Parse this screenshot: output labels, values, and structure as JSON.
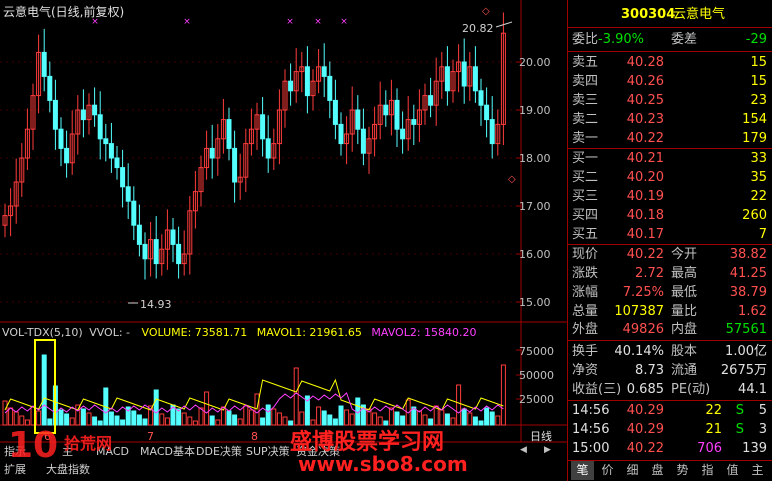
{
  "chart": {
    "title": "云意电气(日线,前复权)",
    "high_label": "20.82",
    "low_label": "14.93",
    "price_axis": [
      "20.00",
      "19.00",
      "18.00",
      "17.00",
      "16.00",
      "15.00"
    ],
    "vol_axis": [
      "75000",
      "50000",
      "25000"
    ],
    "vol_indicator": "VOL-TDX(5,10)",
    "vol_vvol": "VVOL: -",
    "vol_volume": "VOLUME: 73581.71",
    "vol_mavol1": "MAVOL1: 21961.65",
    "vol_mavol2": "MAVOL2: 15840.20",
    "month_marks": [
      "6",
      "7",
      "8"
    ],
    "period_label": "日线",
    "tabs_row1": [
      "指示",
      "主",
      "MACD",
      "MACD基本",
      "DDE决策",
      "SUP决策",
      "资金决策"
    ],
    "tabs_row2": [
      "扩展",
      "大盘指数"
    ],
    "colors": {
      "up": "#ff3c3c",
      "down": "#54ffff",
      "ma1": "#ffff00",
      "ma2": "#ff40ff",
      "border": "#a00000"
    }
  },
  "quote": {
    "code": "300304",
    "name": "云意电气",
    "weibi_label": "委比",
    "weibi": "-3.90%",
    "weicha_label": "委差",
    "weicha": "-29",
    "asks": [
      {
        "label": "卖五",
        "price": "40.28",
        "vol": "15"
      },
      {
        "label": "卖四",
        "price": "40.26",
        "vol": "15"
      },
      {
        "label": "卖三",
        "price": "40.25",
        "vol": "23"
      },
      {
        "label": "卖二",
        "price": "40.23",
        "vol": "154"
      },
      {
        "label": "卖一",
        "price": "40.22",
        "vol": "179"
      }
    ],
    "bids": [
      {
        "label": "买一",
        "price": "40.21",
        "vol": "33"
      },
      {
        "label": "买二",
        "price": "40.20",
        "vol": "35"
      },
      {
        "label": "买三",
        "price": "40.19",
        "vol": "22"
      },
      {
        "label": "买四",
        "price": "40.18",
        "vol": "260"
      },
      {
        "label": "买五",
        "price": "40.17",
        "vol": "7"
      }
    ],
    "stats": [
      {
        "l1": "现价",
        "v1": "40.22",
        "c1": "red",
        "l2": "今开",
        "v2": "38.82",
        "c2": "red"
      },
      {
        "l1": "涨跌",
        "v1": "2.72",
        "c1": "red",
        "l2": "最高",
        "v2": "41.25",
        "c2": "red"
      },
      {
        "l1": "涨幅",
        "v1": "7.25%",
        "c1": "red",
        "l2": "最低",
        "v2": "38.79",
        "c2": "red"
      },
      {
        "l1": "总量",
        "v1": "107387",
        "c1": "yel",
        "l2": "量比",
        "v2": "1.62",
        "c2": "red"
      }
    ],
    "outer": {
      "l1": "外盘",
      "v1": "49826",
      "l2": "内盘",
      "v2": "57561"
    },
    "fund": [
      {
        "l1": "换手",
        "v1": "40.14%",
        "l2": "股本",
        "v2": "1.00亿"
      },
      {
        "l1": "净资",
        "v1": "8.73",
        "l2": "流通",
        "v2": "2675万"
      },
      {
        "l1": "收益(三)",
        "v1": "0.685",
        "l2": "PE(动)",
        "v2": "44.1"
      }
    ],
    "ticks": [
      {
        "time": "14:56",
        "price": "40.29",
        "vol": "22",
        "bs": "S",
        "n": "5"
      },
      {
        "time": "14:56",
        "price": "40.29",
        "vol": "21",
        "bs": "S",
        "n": "3"
      },
      {
        "time": "15:00",
        "price": "40.22",
        "vol": "706",
        "bs": "",
        "n": "139"
      }
    ],
    "bottom_tabs": [
      "笔",
      "价",
      "细",
      "盘",
      "势",
      "指",
      "值",
      "主"
    ]
  },
  "watermark": {
    "left_text": "拾荒网",
    "center_text": "盛博股票学习网",
    "url": "www.sbo8.com"
  }
}
